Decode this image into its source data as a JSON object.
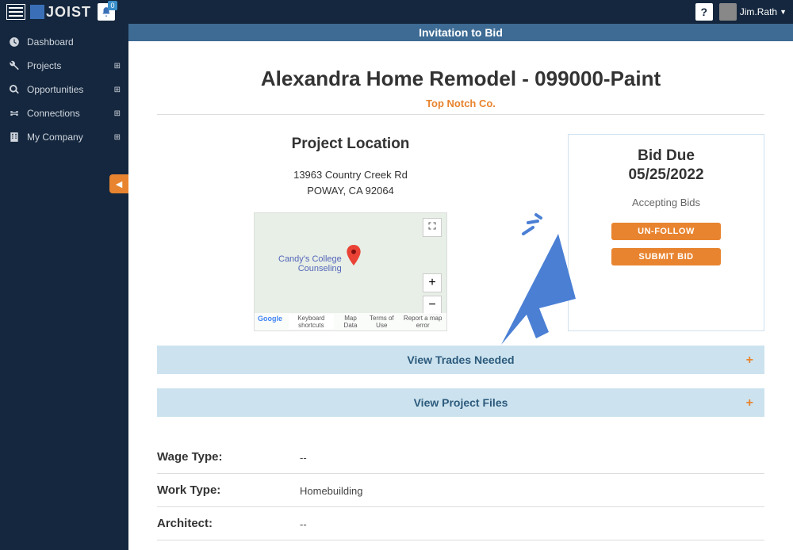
{
  "header": {
    "logo_text": "JOIST",
    "notif_count": "0",
    "help": "?",
    "user_name": "Jim.Rath"
  },
  "sidebar": {
    "items": [
      {
        "label": "Dashboard",
        "has_plus": false
      },
      {
        "label": "Projects",
        "has_plus": true
      },
      {
        "label": "Opportunities",
        "has_plus": true
      },
      {
        "label": "Connections",
        "has_plus": true
      },
      {
        "label": "My Company",
        "has_plus": true
      }
    ]
  },
  "page": {
    "bar_title": "Invitation to Bid",
    "project_title": "Alexandra Home Remodel - 099000-Paint",
    "company": "Top Notch Co.",
    "location_heading": "Project Location",
    "address_line1": "13963 Country Creek Rd",
    "address_line2": "POWAY, CA 92064",
    "map": {
      "poi_label": "Candy's College\nCounseling",
      "google": "Google",
      "kbd": "Keyboard shortcuts",
      "mapdata": "Map Data",
      "terms": "Terms of Use",
      "report": "Report a map error"
    },
    "bid": {
      "due_label": "Bid Due",
      "due_date": "05/25/2022",
      "status": "Accepting Bids",
      "unfollow": "UN-FOLLOW",
      "submit": "SUBMIT BID"
    },
    "accordion1": "View Trades Needed",
    "accordion2": "View Project Files",
    "details": [
      {
        "label": "Wage Type:",
        "value": "--"
      },
      {
        "label": "Work Type:",
        "value": "Homebuilding"
      },
      {
        "label": "Architect:",
        "value": "--"
      }
    ]
  }
}
